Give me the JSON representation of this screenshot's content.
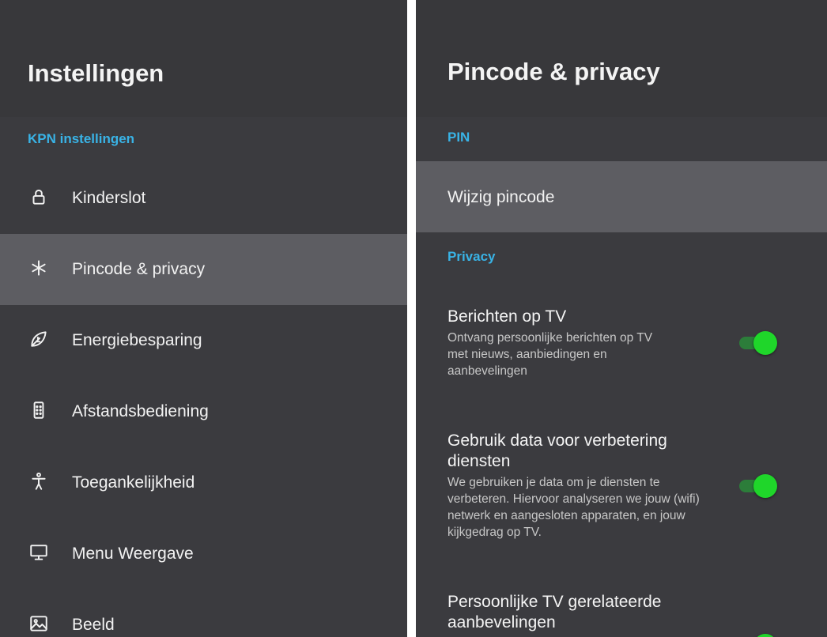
{
  "left": {
    "title": "Instellingen",
    "section_label": "KPN instellingen",
    "items": [
      {
        "label": "Kinderslot",
        "icon": "lock-icon"
      },
      {
        "label": "Pincode & privacy",
        "icon": "asterisk-icon",
        "selected": true
      },
      {
        "label": "Energiebesparing",
        "icon": "leaf-icon"
      },
      {
        "label": "Afstandsbediening",
        "icon": "remote-control-icon"
      },
      {
        "label": "Toegankelijkheid",
        "icon": "accessibility-icon"
      },
      {
        "label": "Menu Weergave",
        "icon": "monitor-icon"
      },
      {
        "label": "Beeld",
        "icon": "image-icon"
      }
    ]
  },
  "right": {
    "title": "Pincode & privacy",
    "pin_section": "PIN",
    "change_pin": "Wijzig pincode",
    "privacy_section": "Privacy",
    "prefs": [
      {
        "title": "Berichten op TV",
        "description": "Ontvang persoonlijke berichten op TV met nieuws, aanbiedingen en aanbevelingen",
        "enabled": true
      },
      {
        "title": "Gebruik data voor verbetering diensten",
        "description": "We gebruiken je data om je diensten te verbeteren. Hiervoor analyseren we jouw (wifi) netwerk en aangesloten apparaten, en jouw kijkgedrag op TV.",
        "enabled": true
      },
      {
        "title": "Persoonlijke TV gerelateerde aanbevelingen",
        "description": "",
        "enabled": true
      }
    ]
  },
  "colors": {
    "panel_bg": "#3b3b3f",
    "header_bg": "#38383b",
    "selected_bg": "#5d5d62",
    "accent": "#39b3e6",
    "toggle_on": "#1fd62a",
    "toggle_track": "#2c7d3a",
    "divider": "#ffffff"
  }
}
